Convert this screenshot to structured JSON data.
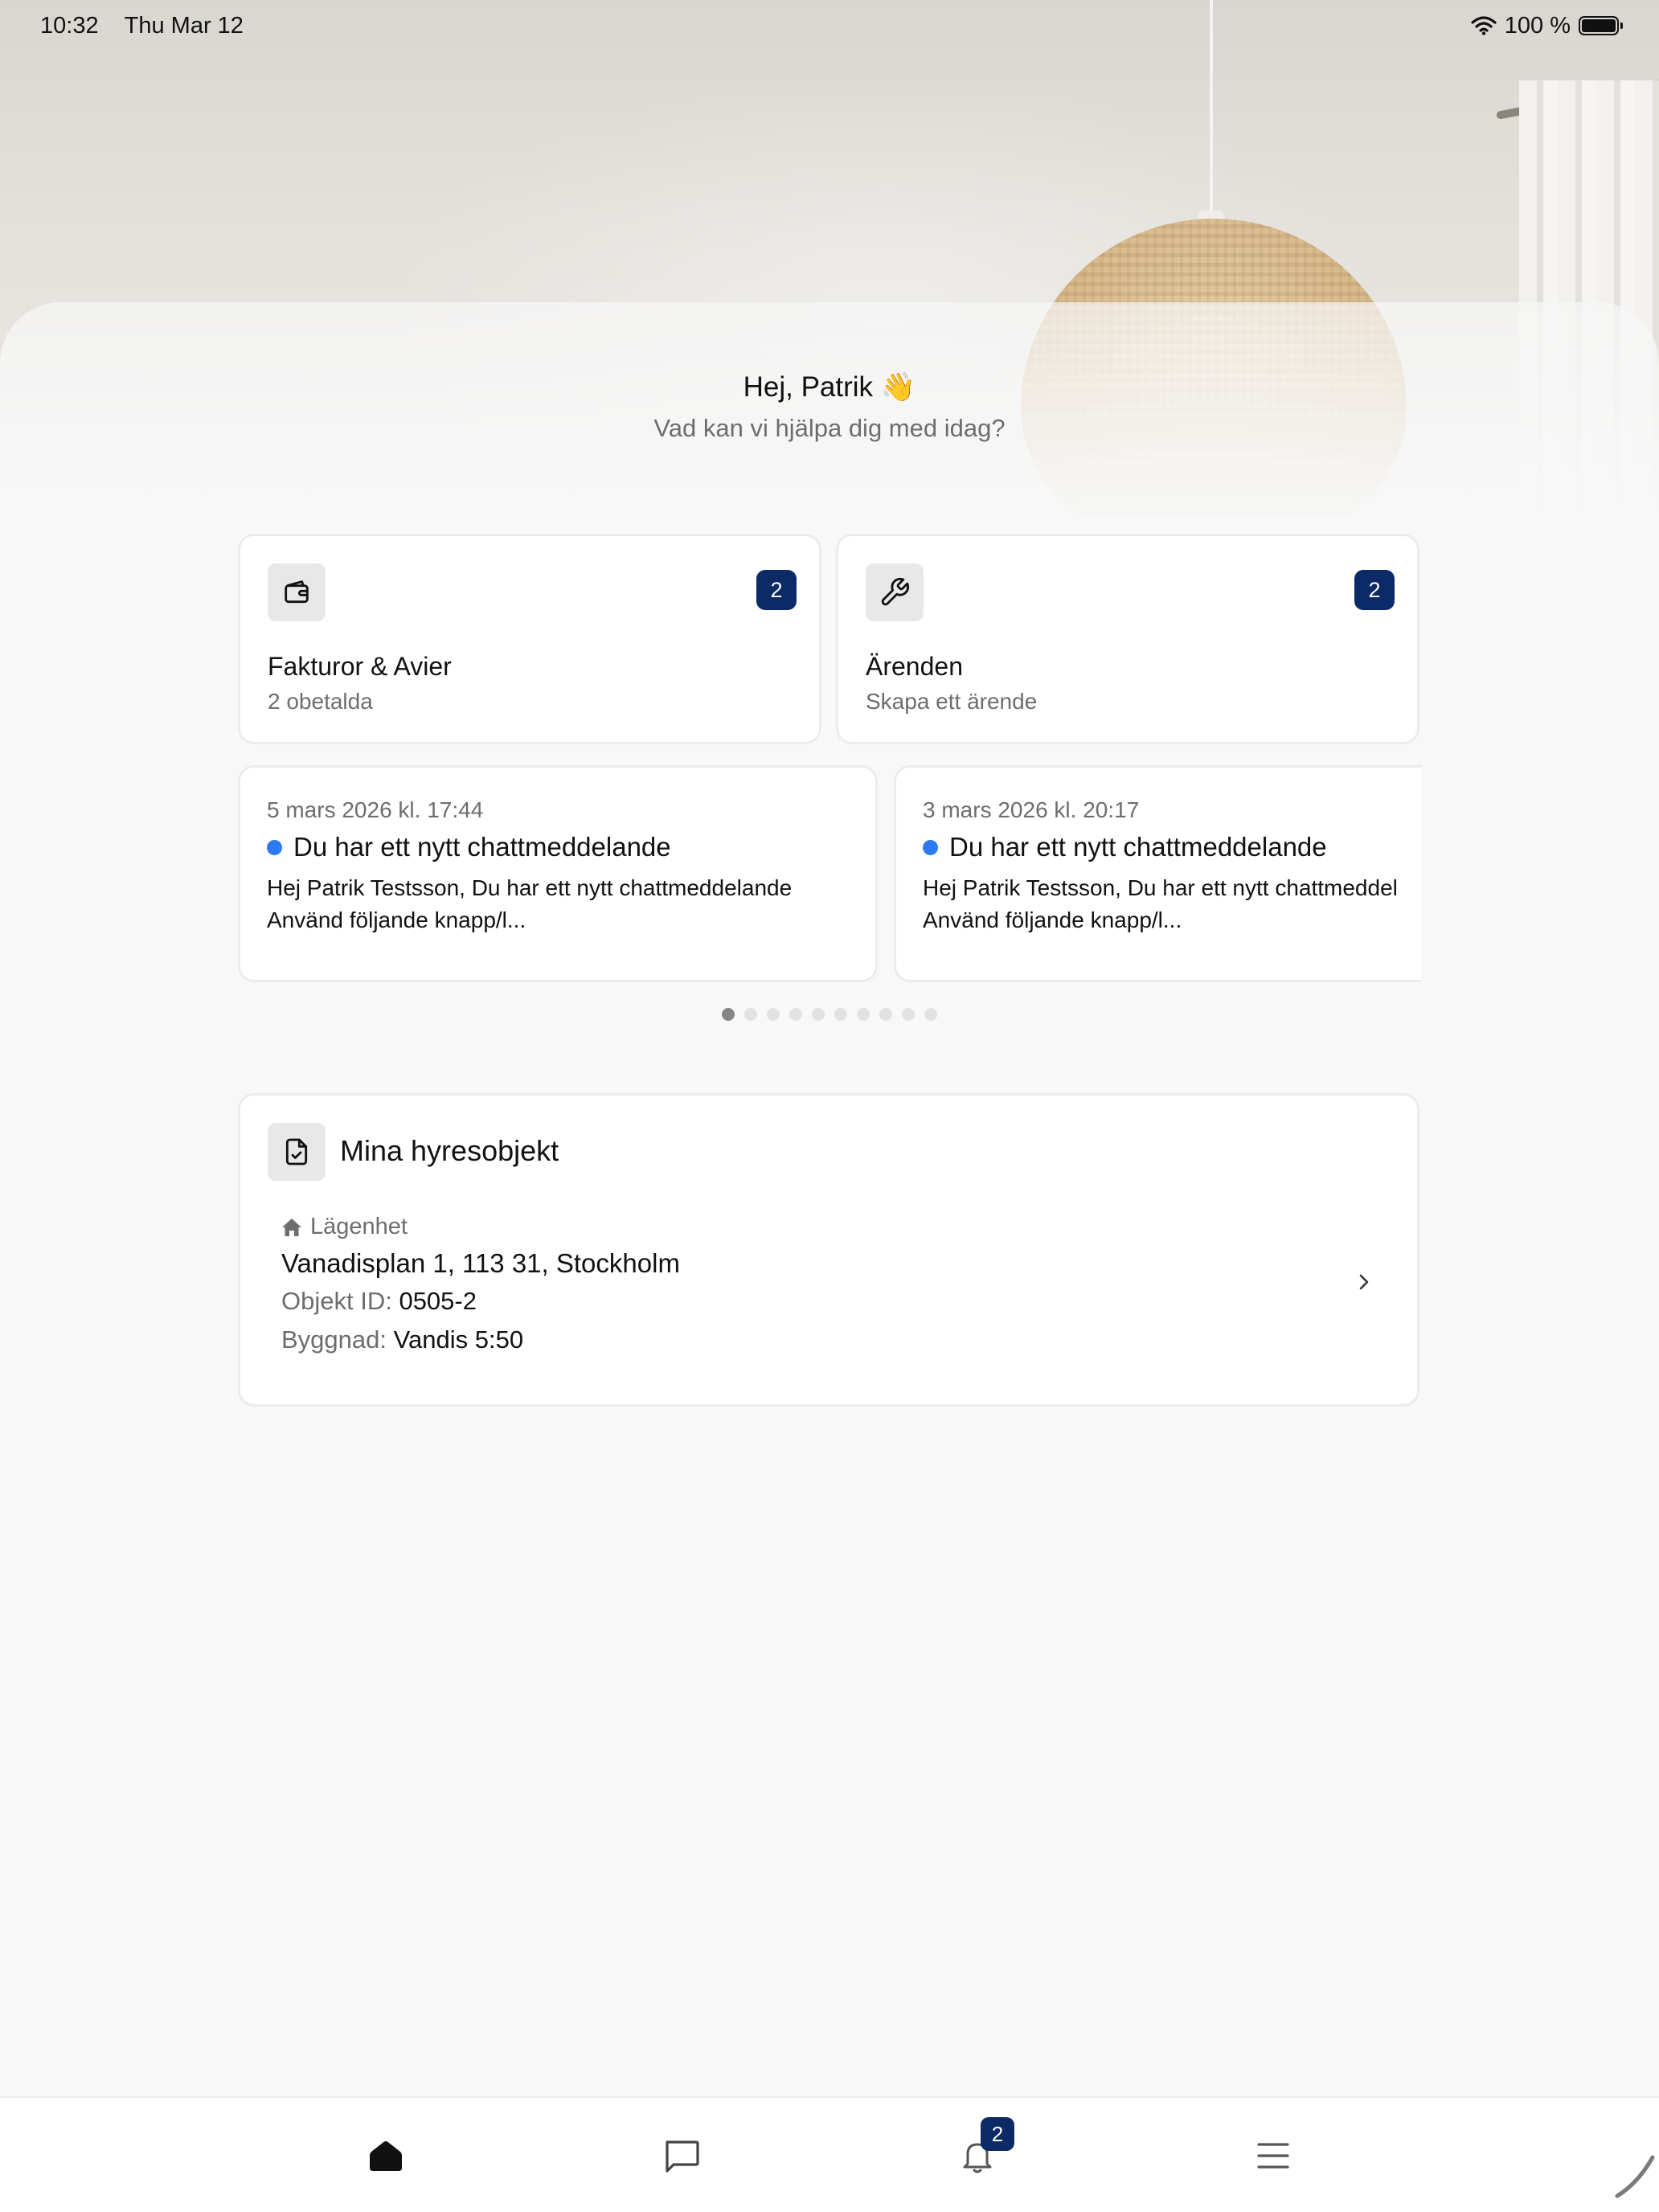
{
  "status_bar": {
    "time": "10:32",
    "date": "Thu Mar 12",
    "battery": "100 %",
    "icons": [
      "wifi-icon",
      "battery-icon"
    ]
  },
  "greeting": {
    "title": "Hej, Patrik 👋",
    "subtitle": "Vad kan vi hjälpa dig med idag?"
  },
  "tiles": [
    {
      "icon": "wallet-icon",
      "title": "Fakturor & Avier",
      "subtitle": "2 obetalda",
      "badge": "2"
    },
    {
      "icon": "wrench-icon",
      "title": "Ärenden",
      "subtitle": "Skapa ett ärende",
      "badge": "2"
    }
  ],
  "notifications": [
    {
      "date": "5 mars 2026 kl. 17:44",
      "title": "Du har ett nytt chattmeddelande",
      "body_line1": "Hej Patrik Testsson, Du har ett nytt chattmeddelande",
      "body_line2": "Använd följande knapp/l..."
    },
    {
      "date": "3 mars 2026 kl. 20:17",
      "title": "Du har ett nytt chattmeddelande",
      "body_line1": "Hej Patrik Testsson, Du har ett nytt chattmeddel",
      "body_line2": "Använd följande knapp/l..."
    }
  ],
  "pager": {
    "count": 10,
    "active_index": 0
  },
  "rental": {
    "icon": "document-check-icon",
    "title": "Mina hyresobjekt",
    "type_icon": "home-icon",
    "type": "Lägenhet",
    "address": "Vanadisplan 1, 113 31, Stockholm",
    "object_id_label": "Objekt ID:",
    "object_id": "0505-2",
    "building_label": "Byggnad:",
    "building": "Vandis 5:50"
  },
  "tabbar": {
    "items": [
      "home-icon",
      "chat-icon",
      "bell-icon",
      "menu-icon"
    ],
    "active": "home-icon",
    "notifications_badge": "2"
  },
  "colors": {
    "badge": "#0b2a66",
    "unread_dot": "#2c7bf5",
    "background": "#f8f8f8"
  }
}
